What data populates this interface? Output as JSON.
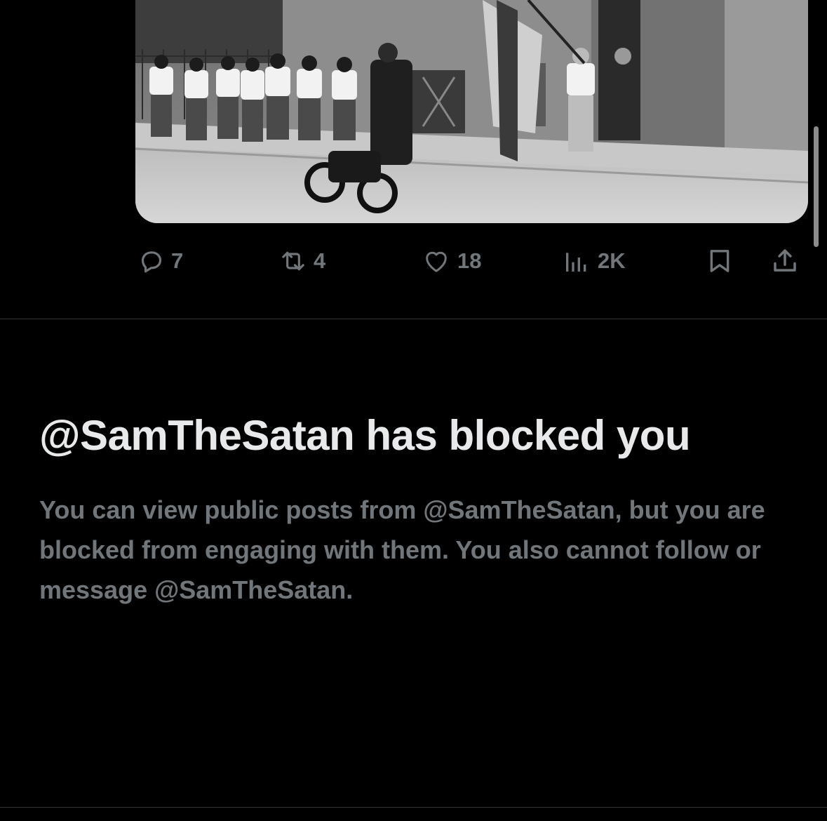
{
  "post": {
    "media": {
      "icon": "photo-media"
    },
    "actions": {
      "reply": {
        "icon": "reply-icon",
        "count": "7"
      },
      "repost": {
        "icon": "repost-icon",
        "count": "4"
      },
      "like": {
        "icon": "heart-icon",
        "count": "18"
      },
      "views": {
        "icon": "views-chart-icon",
        "count": "2K"
      },
      "bookmark": {
        "icon": "bookmark-icon"
      },
      "share": {
        "icon": "share-icon"
      }
    }
  },
  "blocked_notice": {
    "title": "@SamTheSatan has blocked you",
    "body": "You can view public posts from @SamTheSatan, but you are blocked from engaging with them. You also cannot follow or message @SamTheSatan."
  },
  "colors": {
    "background": "#000000",
    "primary_text": "#e7e9ea",
    "secondary_text": "#71767b",
    "divider": "#2f3336"
  }
}
